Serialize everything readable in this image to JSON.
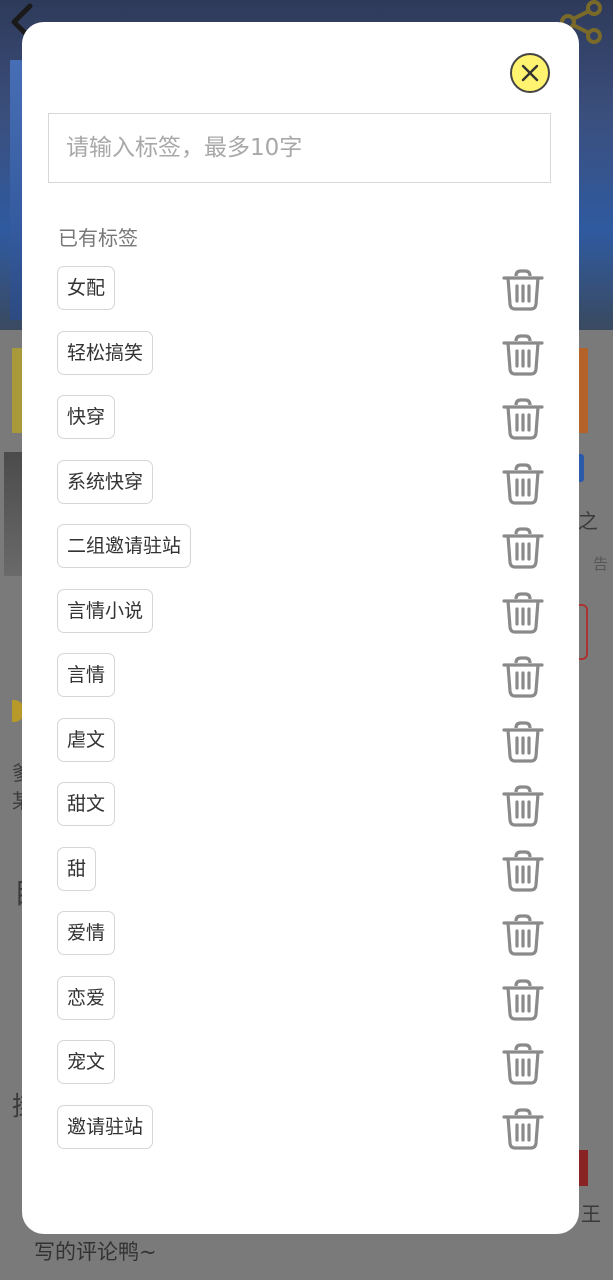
{
  "background": {
    "side_text_right": "之",
    "ad_label": "告",
    "left_glyph_1": "爹",
    "left_glyph_2": "某",
    "left_glyph_3": "目",
    "left_glyph_4": "掛",
    "right_glyph": "王",
    "comment_line": "写的评论鸭~"
  },
  "modal": {
    "input_placeholder": "请输入标签，最多10字",
    "input_value": "",
    "existing_tags_label": "已有标签",
    "tags": [
      {
        "label": "女配"
      },
      {
        "label": "轻松搞笑"
      },
      {
        "label": "快穿"
      },
      {
        "label": "系统快穿"
      },
      {
        "label": "二组邀请驻站"
      },
      {
        "label": "言情小说"
      },
      {
        "label": "言情"
      },
      {
        "label": "虐文"
      },
      {
        "label": "甜文"
      },
      {
        "label": "甜"
      },
      {
        "label": "爱情"
      },
      {
        "label": "恋爱"
      },
      {
        "label": "宠文"
      },
      {
        "label": "邀请驻站"
      }
    ],
    "icons": {
      "close": "close-icon",
      "delete": "trash-icon"
    },
    "colors": {
      "close_button": "#fff36f",
      "trash": "#8a8a8a"
    }
  }
}
